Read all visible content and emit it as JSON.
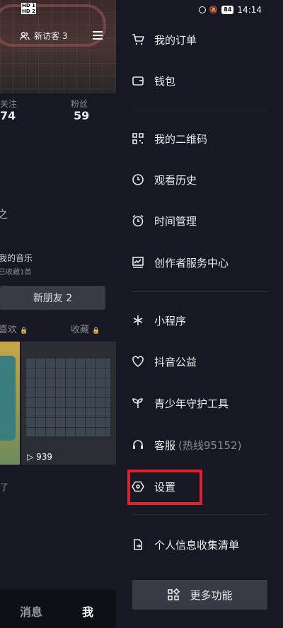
{
  "status_bar": {
    "left_badges": [
      "HD 1",
      "HD 2"
    ],
    "signal_text": "5G",
    "battery": "84",
    "time": "14:14"
  },
  "profile": {
    "new_visitors": "新访客 3",
    "stats": [
      {
        "label": "关注",
        "value": "74"
      },
      {
        "label": "粉丝",
        "value": "59"
      }
    ],
    "partial_char": "之",
    "music_title": "我的音乐",
    "music_sub": "已收藏1首",
    "new_friend_button": "新朋友 2",
    "tabs": [
      {
        "label": "喜欢"
      },
      {
        "label": "收藏"
      }
    ],
    "video_count": "939",
    "partial_text": "了",
    "bottom_nav": {
      "messages": "消息",
      "me": "我"
    }
  },
  "drawer": {
    "items": [
      {
        "label": "我的订单",
        "icon": "cart-icon"
      },
      {
        "label": "钱包",
        "icon": "wallet-icon"
      },
      {
        "label": "我的二维码",
        "icon": "qr-code-icon"
      },
      {
        "label": "观看历史",
        "icon": "clock-icon"
      },
      {
        "label": "时间管理",
        "icon": "alarm-icon"
      },
      {
        "label": "创作者服务中心",
        "icon": "chart-icon"
      },
      {
        "label": "小程序",
        "icon": "asterisk-icon"
      },
      {
        "label": "抖音公益",
        "icon": "heart-icon"
      },
      {
        "label": "青少年守护工具",
        "icon": "sprout-icon"
      },
      {
        "label": "客服",
        "hint": "(热线95152)",
        "icon": "headset-icon"
      },
      {
        "label": "设置",
        "icon": "settings-hexagon-icon"
      },
      {
        "label": "个人信息收集清单",
        "icon": "document-export-icon"
      }
    ],
    "more_button": "更多功能",
    "highlight_color": "#e0202b"
  }
}
